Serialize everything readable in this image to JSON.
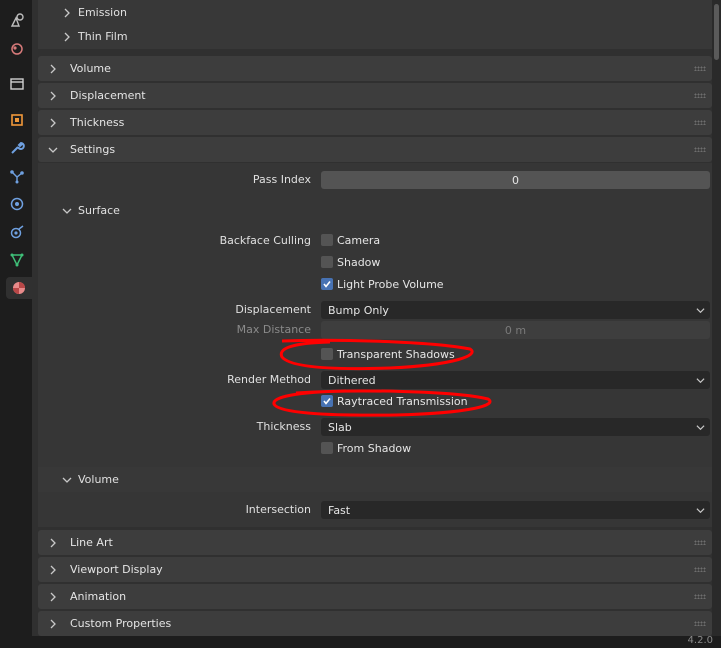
{
  "tabs": [
    {
      "icon": "tool-icon"
    },
    {
      "icon": "render-icon"
    },
    {
      "icon": "output-icon"
    },
    {
      "icon": "object-icon"
    },
    {
      "icon": "modifier-icon"
    },
    {
      "icon": "particles-icon"
    },
    {
      "icon": "physics-icon"
    },
    {
      "icon": "constraints-icon"
    },
    {
      "icon": "data-icon"
    },
    {
      "icon": "material-icon",
      "active": true
    }
  ],
  "top_subpanels": [
    "Emission",
    "Thin Film"
  ],
  "panels": {
    "volume": "Volume",
    "displacement": "Displacement",
    "thickness": "Thickness",
    "settings": "Settings",
    "line_art": "Line Art",
    "viewport_display": "Viewport Display",
    "animation": "Animation",
    "custom_properties": "Custom Properties"
  },
  "settings": {
    "pass_index_label": "Pass Index",
    "pass_index_value": "0",
    "surface": {
      "title": "Surface",
      "backface_culling_label": "Backface Culling",
      "camera_label": "Camera",
      "camera_checked": false,
      "shadow_label": "Shadow",
      "shadow_checked": false,
      "light_probe_label": "Light Probe Volume",
      "light_probe_checked": true,
      "displacement_label": "Displacement",
      "displacement_value": "Bump Only",
      "max_distance_label": "Max Distance",
      "max_distance_value": "0 m",
      "transparent_shadows_label": "Transparent Shadows",
      "transparent_shadows_checked": false,
      "render_method_label": "Render Method",
      "render_method_value": "Dithered",
      "raytraced_transmission_label": "Raytraced Transmission",
      "raytraced_transmission_checked": true,
      "thickness_label": "Thickness",
      "thickness_value": "Slab",
      "from_shadow_label": "From Shadow",
      "from_shadow_checked": false
    },
    "volume": {
      "title": "Volume",
      "intersection_label": "Intersection",
      "intersection_value": "Fast"
    }
  },
  "footer": {
    "version": "4.2.0"
  },
  "colors": {
    "accent": "#4772b3",
    "annotation": "#ff0000"
  }
}
